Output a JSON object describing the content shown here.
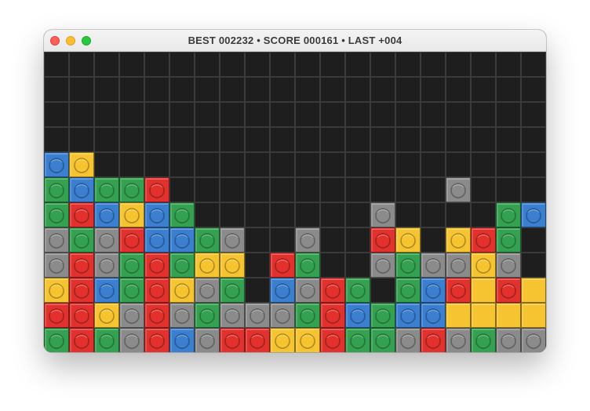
{
  "window": {
    "title": "BEST 002232 • SCORE 000161 • LAST +004"
  },
  "board": {
    "columns": 20,
    "rows": 12,
    "empty_color": "#1e1e1e",
    "grid_color": "#3a3a3a",
    "colors": {
      "B": {
        "fill": "#3a7fd0",
        "name": "blue"
      },
      "Y": {
        "fill": "#f6c431",
        "name": "yellow"
      },
      "G": {
        "fill": "#34a150",
        "name": "green"
      },
      "R": {
        "fill": "#e2312d",
        "name": "red"
      },
      "K": {
        "fill": "#8b8b8b",
        "name": "gray"
      }
    },
    "cells": [
      "....................",
      "....................",
      "....................",
      "....................",
      "BY..................",
      "GBGGR...........K...",
      "GRBYBG.......K....GB",
      "KGKRBBGK..K..RY.YRG.",
      "KRKGRGYY.RG..KGKKYK.",
      "YRBGRYKG.BKRG.GBRYRY",
      "RRYKRKGKKKGRBGBBYYYY",
      "GRGKRBKRRYYRGGKRKGKK"
    ],
    "plain_cells": [
      [
        9,
        17
      ],
      [
        9,
        19
      ],
      [
        10,
        16
      ],
      [
        10,
        17
      ],
      [
        10,
        18
      ],
      [
        10,
        19
      ]
    ]
  }
}
